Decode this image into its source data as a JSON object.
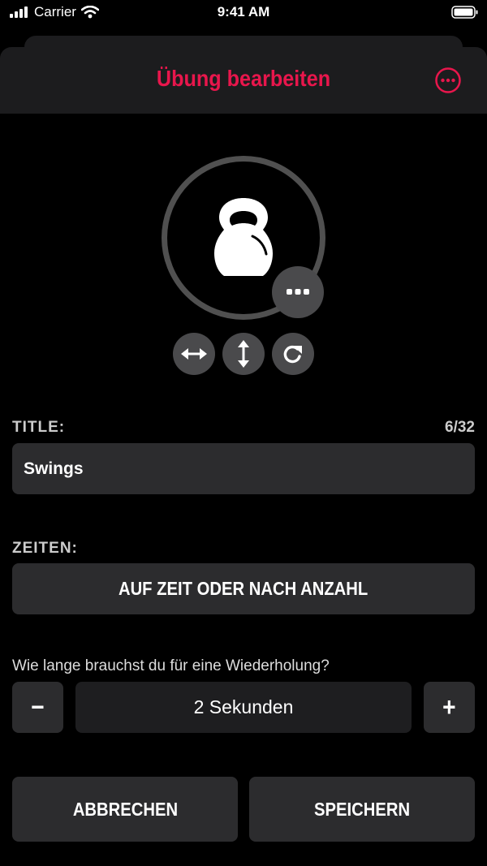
{
  "status_bar": {
    "carrier": "Carrier",
    "time": "9:41 AM"
  },
  "header": {
    "title": "Übung bearbeiten"
  },
  "avatar": {
    "icon": "kettlebell-icon"
  },
  "title_field": {
    "label": "TITLE:",
    "counter": "6/32",
    "value": "Swings"
  },
  "times": {
    "label": "ZEITEN:",
    "mode_button": "AUF ZEIT ODER NACH ANZAHL"
  },
  "repetition": {
    "question": "Wie lange brauchst du für eine Wiederholung?",
    "minus": "−",
    "value": "2 Sekunden",
    "plus": "+"
  },
  "actions": {
    "cancel": "ABBRECHEN",
    "save": "SPEICHERN"
  },
  "colors": {
    "accent": "#e8164c",
    "background": "#000000",
    "surface": "#2c2c2e"
  }
}
